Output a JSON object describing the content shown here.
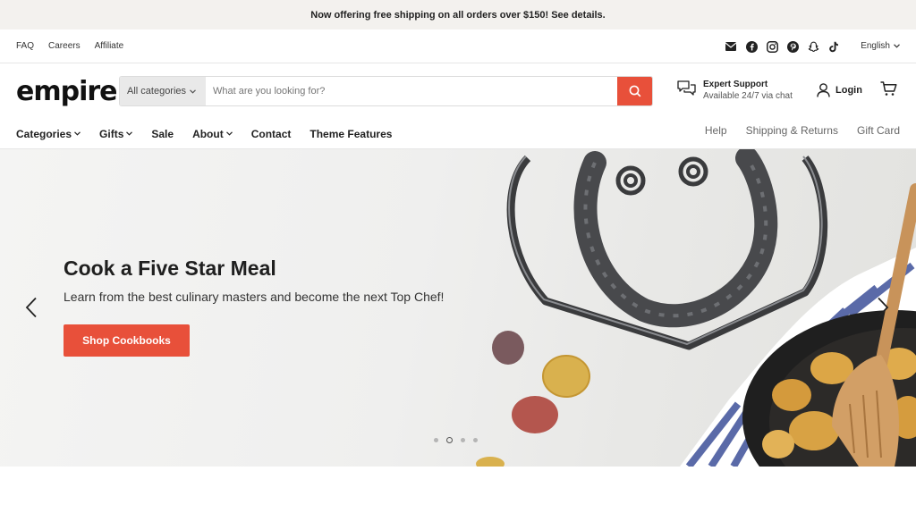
{
  "announcement": "Now offering free shipping on all orders over $150! See details.",
  "utility": {
    "links": [
      "FAQ",
      "Careers",
      "Affiliate"
    ],
    "social_icons": [
      "mail-icon",
      "facebook-icon",
      "instagram-icon",
      "pinterest-icon",
      "snapchat-icon",
      "tiktok-icon"
    ],
    "language": "English"
  },
  "header": {
    "logo": "empire",
    "search_category": "All categories",
    "search_placeholder": "What are you looking for?",
    "support_title": "Expert Support",
    "support_subtitle": "Available 24/7 via chat",
    "login": "Login"
  },
  "nav": {
    "left": [
      {
        "label": "Categories",
        "dropdown": true
      },
      {
        "label": "Gifts",
        "dropdown": true
      },
      {
        "label": "Sale",
        "dropdown": false
      },
      {
        "label": "About",
        "dropdown": true
      },
      {
        "label": "Contact",
        "dropdown": false
      },
      {
        "label": "Theme Features",
        "dropdown": false
      }
    ],
    "right": [
      "Help",
      "Shipping & Returns",
      "Gift Card"
    ]
  },
  "hero": {
    "title": "Cook a Five Star Meal",
    "subtitle": "Learn from the best culinary masters and become the next Top Chef!",
    "cta": "Shop Cookbooks",
    "slide_count": 4,
    "active_slide": 2
  },
  "colors": {
    "accent": "#e8503a",
    "announcement_bg": "#f3f1ee"
  }
}
